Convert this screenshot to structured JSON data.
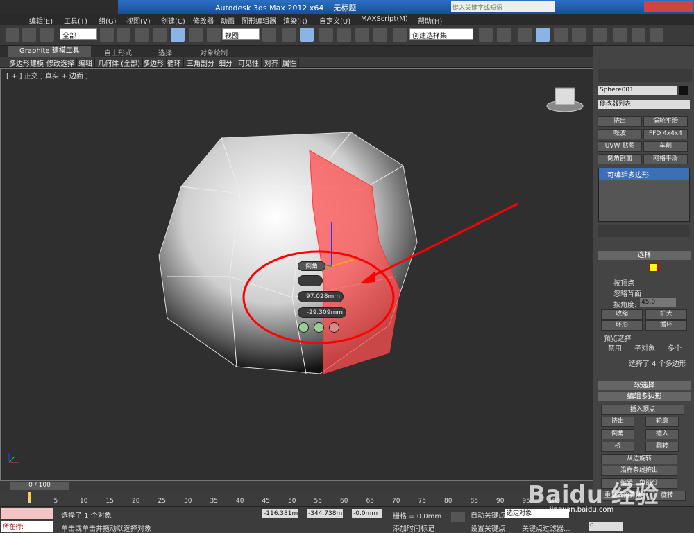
{
  "titlebar": {
    "app_title": "Autodesk 3ds Max  2012 x64",
    "file": "无标题",
    "search_placeholder": "键入关键字或短语"
  },
  "menu": [
    "编辑(E)",
    "工具(T)",
    "组(G)",
    "视图(V)",
    "创建(C)",
    "修改器",
    "动画",
    "图形编辑器",
    "渲染(R)",
    "自定义(U)",
    "MAXScript(M)",
    "帮助(H)"
  ],
  "toolbar": {
    "selection_filter": "全部",
    "ref_coord": "视图",
    "named_selection": "创建选择集"
  },
  "ribbon": {
    "tabs": [
      "Graphite 建模工具",
      "自由形式",
      "选择",
      "对象绘制"
    ],
    "panels": [
      "多边形建模",
      "修改选择",
      "编辑",
      "几何体 (全部)",
      "多边形",
      "循环",
      "三角剖分",
      "细分",
      "可见性",
      "对齐",
      "属性"
    ]
  },
  "viewport": {
    "label": "[ + ] 正交 ] 真实 + 边面 ]",
    "caddy": {
      "title": "倒角",
      "height": "97.028mm",
      "outline": "-29.309mm"
    }
  },
  "cmd": {
    "object_name": "Sphere001",
    "modifier_list": "修改器列表",
    "mod_buttons": [
      "挤出",
      "涡轮平滑",
      "噪波",
      "FFD 4x4x4",
      "UVW 贴图",
      "车削",
      "倒角剖面",
      "网格平滑"
    ],
    "stack_item": "可编辑多边形",
    "select": {
      "header": "选择",
      "by_vertex": "按顶点",
      "ignore_back": "忽略背面",
      "by_angle": "按角度:",
      "angle": "45.0",
      "shrink": "收缩",
      "grow": "扩大",
      "ring": "环形",
      "loop": "循环",
      "preview": "预览选择",
      "disabled": "禁用",
      "subobj": "子对象",
      "multi": "多个",
      "status": "选择了 4 个多边形"
    },
    "soft": "软选择",
    "edit_poly": "编辑多边形",
    "edit_buttons": [
      "插入顶点",
      "挤出",
      "轮廓",
      "倒角",
      "插入",
      "桥",
      "翻转",
      "从边旋转",
      "沿样条线挤出",
      "编辑三角剖分",
      "重复三角算法",
      "旋转"
    ]
  },
  "timeline": {
    "frame": "0 / 100",
    "ticks": [
      "0",
      "5",
      "10",
      "15",
      "20",
      "25",
      "30",
      "35",
      "40",
      "45",
      "50",
      "55",
      "60",
      "65",
      "70",
      "75",
      "80",
      "85",
      "90",
      "95",
      "100"
    ]
  },
  "status": {
    "mode": "所在行:",
    "selected": "选择了 1 个对象",
    "hint": "单击或单击并拖动以选择对象",
    "x": "-116.381m",
    "y": "-344.738m",
    "z": "-0.0mm",
    "grid": "栅格 = 0.0mm",
    "add_tag": "添加时间标记",
    "auto_key": "自动关键点",
    "set_key": "设置关键点",
    "sel_set": "选定对象",
    "key_filter": "关键点过滤器...",
    "frame_val": "0"
  },
  "watermark": "Baidu 经验",
  "watermark2": "jingyan.baidu.com"
}
